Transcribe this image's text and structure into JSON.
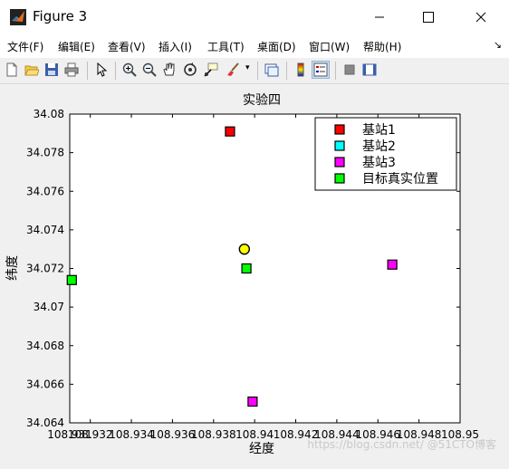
{
  "window": {
    "title": "Figure 3"
  },
  "menu": [
    {
      "label": "文件(F)"
    },
    {
      "label": "编辑(E)"
    },
    {
      "label": "查看(V)"
    },
    {
      "label": "插入(I)"
    },
    {
      "label": "工具(T)"
    },
    {
      "label": "桌面(D)"
    },
    {
      "label": "窗口(W)"
    },
    {
      "label": "帮助(H)"
    }
  ],
  "toolbar": {
    "icons": [
      "new-figure-icon",
      "open-file-icon",
      "save-icon",
      "print-icon",
      "select-arrow-icon",
      "zoom-in-icon",
      "zoom-out-icon",
      "pan-hand-icon",
      "rotate-3d-icon",
      "data-cursor-icon",
      "brush-icon",
      "link-plot-icon",
      "colorbar-icon",
      "legend-icon",
      "hide-plot-tools-icon",
      "show-plot-tools-icon"
    ]
  },
  "colors": {
    "accent_legend_button": "#cfe3f7",
    "axes_bg": "#ffffff",
    "figure_bg": "#f0f0f0"
  },
  "chart_data": {
    "type": "scatter",
    "title": "实验四",
    "xlabel": "经度",
    "ylabel": "纬度",
    "xlim": [
      108.931,
      108.95
    ],
    "ylim": [
      34.064,
      34.08
    ],
    "xticks": [
      "108.931",
      "108.932",
      "108.934",
      "108.936",
      "108.938",
      "108.94",
      "108.942",
      "108.944",
      "108.946",
      "108.948",
      "108.95"
    ],
    "xtick_values": [
      108.931,
      108.932,
      108.934,
      108.936,
      108.938,
      108.94,
      108.942,
      108.944,
      108.946,
      108.948,
      108.95
    ],
    "yticks": [
      "34.064",
      "34.066",
      "34.068",
      "34.07",
      "34.072",
      "34.074",
      "34.076",
      "34.078",
      "34.08"
    ],
    "ytick_values": [
      34.064,
      34.066,
      34.068,
      34.07,
      34.072,
      34.074,
      34.076,
      34.078,
      34.08
    ],
    "grid": false,
    "legend_position": "top-right",
    "series": [
      {
        "name": "基站1",
        "color": "#ff0000",
        "marker": "square",
        "points": [
          [
            108.9388,
            34.0791
          ]
        ]
      },
      {
        "name": "基站2",
        "color": "#00ffff",
        "marker": "square",
        "points": []
      },
      {
        "name": "基站3",
        "color": "#ff00ff",
        "marker": "square",
        "points": [
          [
            108.9467,
            34.0722
          ],
          [
            108.9399,
            34.0651
          ]
        ]
      },
      {
        "name": "目标真实位置",
        "color": "#00ff00",
        "marker": "square",
        "points": [
          [
            108.9311,
            34.0714
          ],
          [
            108.9396,
            34.072
          ]
        ]
      }
    ],
    "extra_points": [
      {
        "color": "#ffff00",
        "marker": "circle",
        "points": [
          [
            108.9395,
            34.073
          ]
        ]
      }
    ]
  },
  "watermark": "https://blog.csdn.net/ @51CTO博客"
}
